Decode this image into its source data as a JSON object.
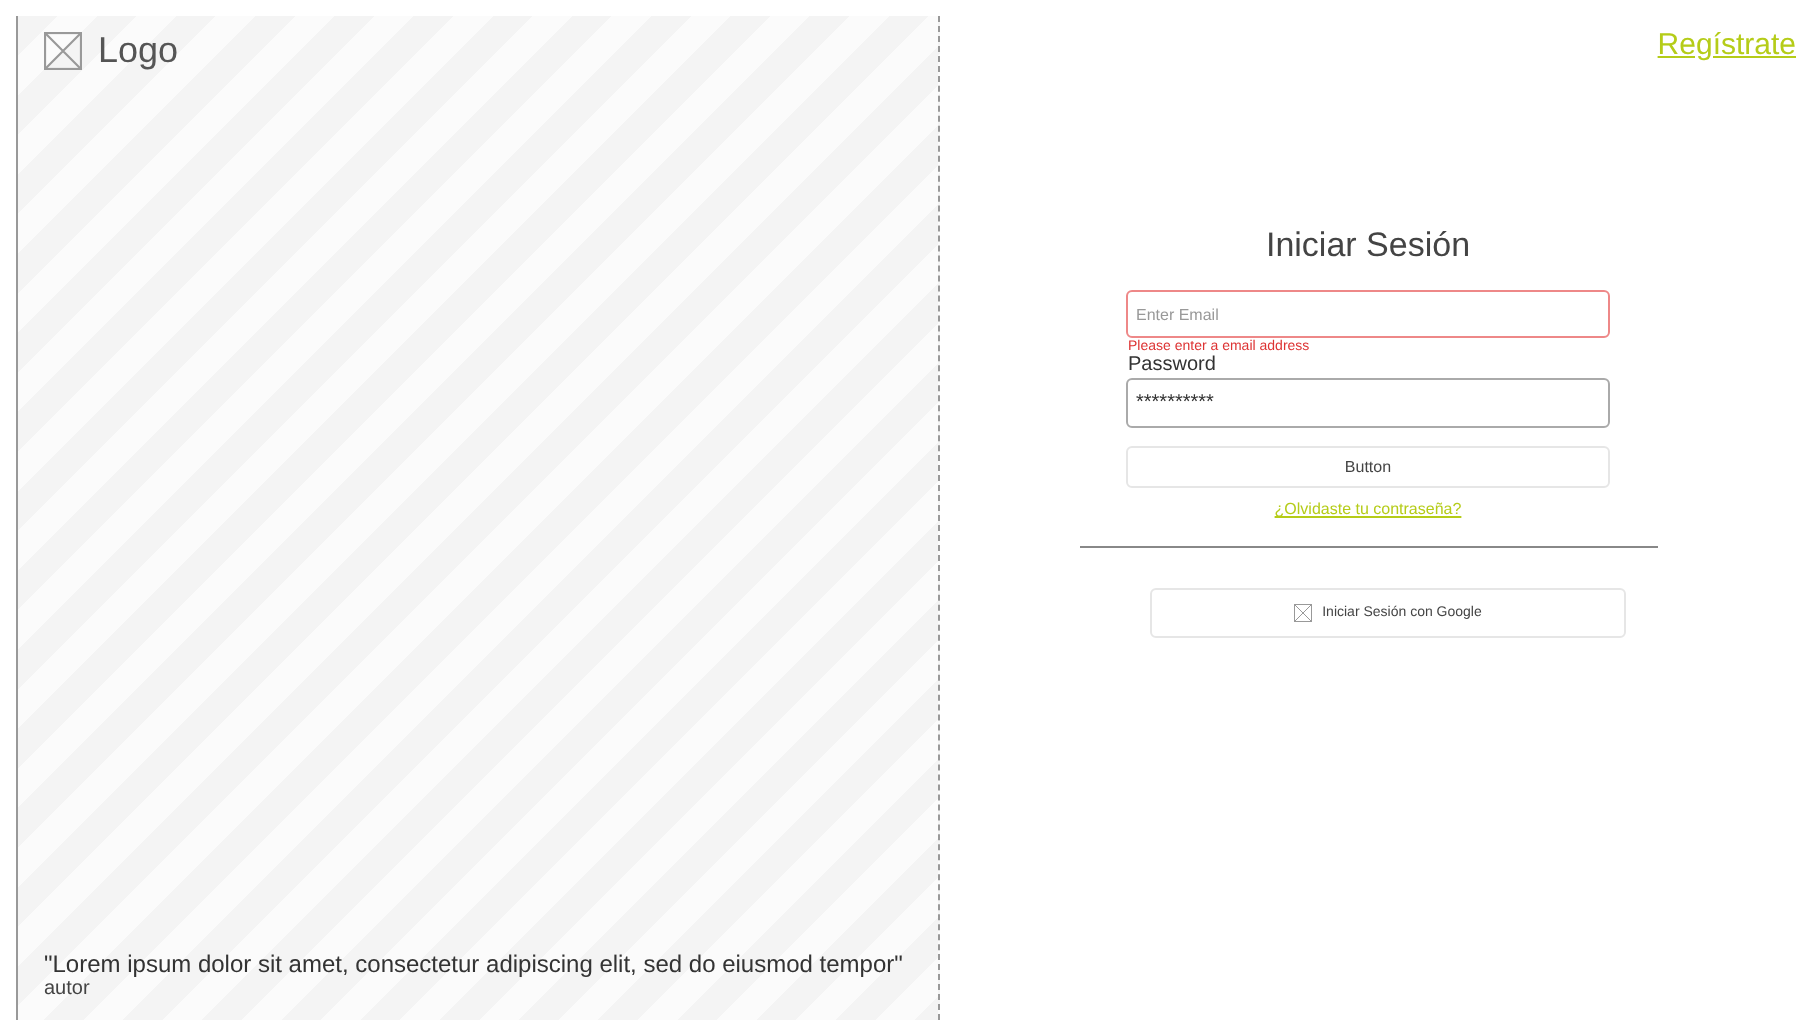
{
  "brand": {
    "logo_text": "Logo"
  },
  "quote": {
    "text": "\"Lorem ipsum dolor sit amet, consectetur adipiscing elit, sed do eiusmod tempor\"",
    "author": "autor"
  },
  "register_link": "Regístrate",
  "login": {
    "title": "Iniciar Sesión",
    "email": {
      "placeholder": "Enter Email",
      "invalid": true,
      "error": "Please enter a email address"
    },
    "password": {
      "label": "Password",
      "value": "**********"
    },
    "submit": "Button",
    "forgot_link": "¿Olvidaste tu contraseña?",
    "google_button": "Iniciar Sesión con Google"
  }
}
